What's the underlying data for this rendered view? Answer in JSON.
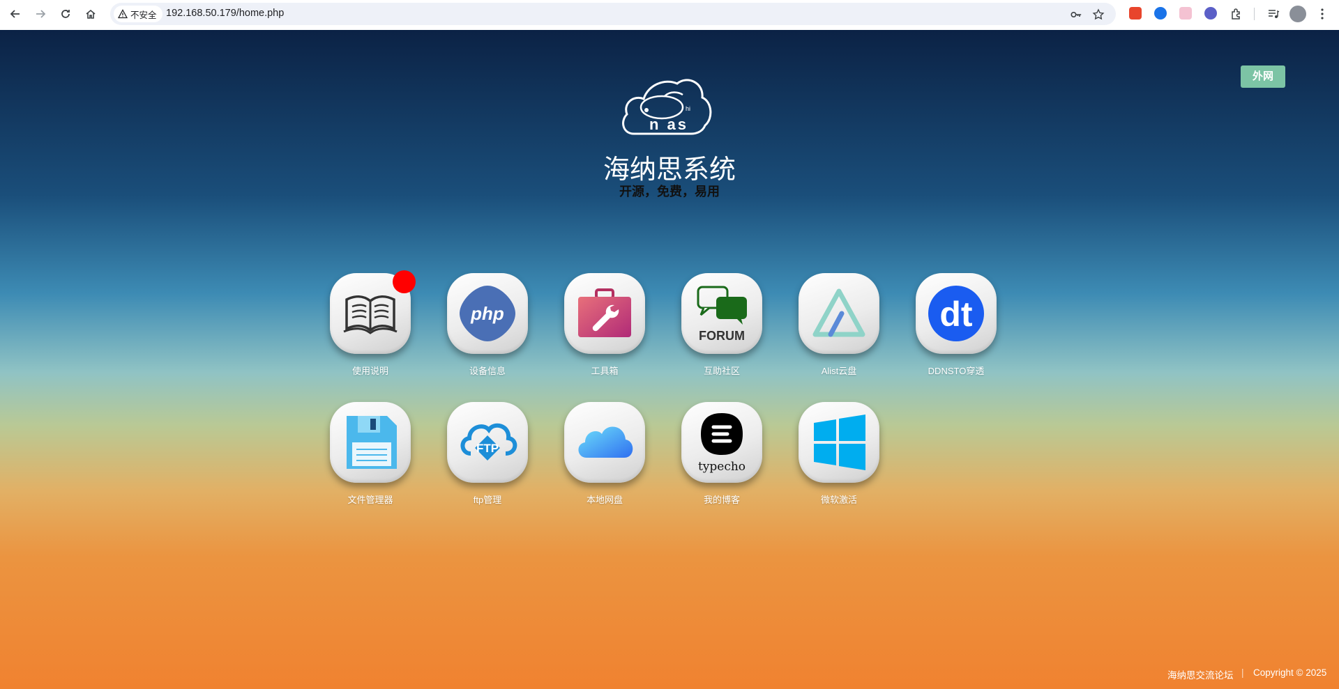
{
  "browser": {
    "security_label": "不安全",
    "url": "192.168.50.179/home.php"
  },
  "page": {
    "external_button": "外网",
    "title": "海纳思系统",
    "subtitle": "开源，免费，易用",
    "logo_text": "n as",
    "logo_small": "hi"
  },
  "apps": [
    {
      "label": "使用说明",
      "icon": "book-icon"
    },
    {
      "label": "设备信息",
      "icon": "php-icon",
      "icon_text": "php"
    },
    {
      "label": "工具箱",
      "icon": "toolbox-icon"
    },
    {
      "label": "互助社区",
      "icon": "forum-icon",
      "icon_text": "FORUM"
    },
    {
      "label": "Alist云盘",
      "icon": "alist-icon"
    },
    {
      "label": "DDNSTO穿透",
      "icon": "ddnsto-icon",
      "icon_text": "dt"
    },
    {
      "label": "文件管理器",
      "icon": "floppy-icon"
    },
    {
      "label": "ftp管理",
      "icon": "ftp-icon",
      "icon_text": "FTP"
    },
    {
      "label": "本地网盘",
      "icon": "cloud-icon"
    },
    {
      "label": "我的博客",
      "icon": "typecho-icon",
      "icon_text": "typecho"
    },
    {
      "label": "微软激活",
      "icon": "windows-icon"
    }
  ],
  "footer": {
    "forum_link": "海纳思交流论坛",
    "divider": "|",
    "copyright": "Copyright © 2025"
  },
  "colors": {
    "external_button": "#7cc4a5",
    "notification_dot": "#ff0000"
  }
}
